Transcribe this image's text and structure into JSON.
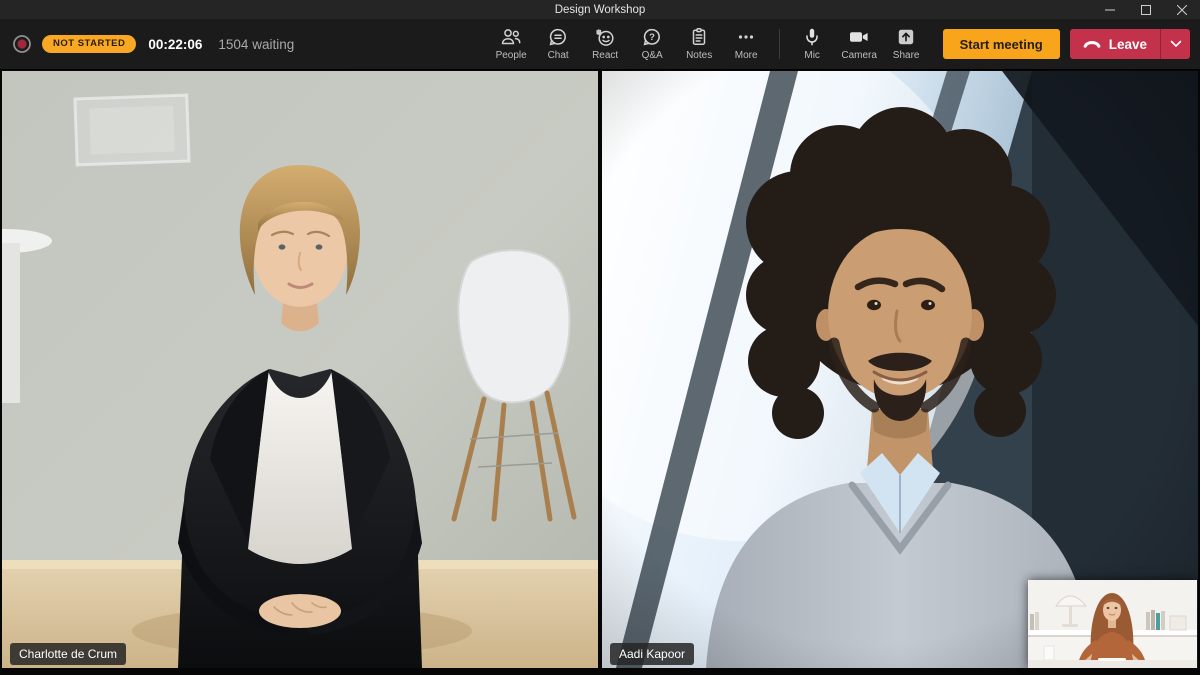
{
  "window": {
    "title": "Design Workshop",
    "controls": [
      "minimize-icon",
      "maximize-icon",
      "close-icon"
    ]
  },
  "toolbar": {
    "record_indicator": "record-icon",
    "status_badge": "NOT STARTED",
    "timer": "00:22:06",
    "waiting": "1504 waiting",
    "nav": [
      {
        "label": "People",
        "icon": "people-icon"
      },
      {
        "label": "Chat",
        "icon": "chat-icon"
      },
      {
        "label": "React",
        "icon": "react-icon"
      },
      {
        "label": "Q&A",
        "icon": "qa-icon"
      },
      {
        "label": "Notes",
        "icon": "notes-icon"
      },
      {
        "label": "More",
        "icon": "more-icon"
      }
    ],
    "devices": [
      {
        "label": "Mic",
        "icon": "mic-icon"
      },
      {
        "label": "Camera",
        "icon": "camera-icon"
      },
      {
        "label": "Share",
        "icon": "share-icon"
      }
    ],
    "start_button": "Start meeting",
    "leave_button": "Leave"
  },
  "participants": [
    {
      "name": "Charlotte de Crum"
    },
    {
      "name": "Aadi Kapoor"
    }
  ],
  "colors": {
    "badge_amber": "#F9A825",
    "start_amber": "#F8A51B",
    "leave_red": "#C4314B",
    "record_red": "#A1283C",
    "toolbar_bg": "#1b1b1b",
    "titlebar_bg": "#252525"
  }
}
